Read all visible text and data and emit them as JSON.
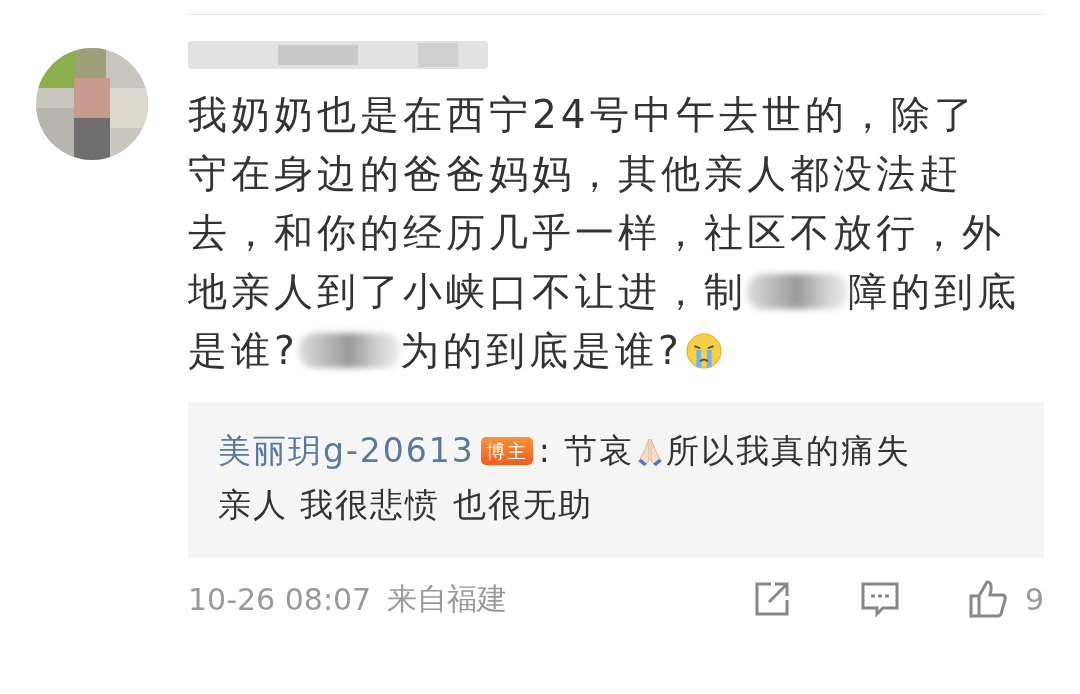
{
  "comment": {
    "lines": [
      [
        {
          "kind": "text",
          "text": "我奶奶也是在西宁24号中午去世的，除了"
        }
      ],
      [
        {
          "kind": "text",
          "text": "守在身边的爸爸妈妈，其他亲人都没法赶"
        }
      ],
      [
        {
          "kind": "text",
          "text": "去，和你的经历几乎一样，社区不放行，外"
        }
      ],
      [
        {
          "kind": "text",
          "text": "地亲人到了小峡口不让进，制"
        },
        {
          "kind": "blur"
        },
        {
          "kind": "text",
          "text": "障的到底"
        }
      ],
      [
        {
          "kind": "text",
          "text": "是谁?"
        },
        {
          "kind": "blur"
        },
        {
          "kind": "text",
          "text": "为的到底是谁?"
        },
        {
          "kind": "emoji"
        }
      ]
    ]
  },
  "reply": {
    "author": "美丽玥g-20613",
    "badge": "博主",
    "parts": [
      {
        "kind": "text",
        "text": ": 节哀"
      },
      {
        "kind": "emoji"
      },
      {
        "kind": "text",
        "text": " 所以我真的痛失"
      }
    ],
    "continuation": "亲人 我很悲愤 也很无助"
  },
  "footer": {
    "time": "10-26 08:07",
    "location": "来自福建",
    "likes": "9"
  }
}
